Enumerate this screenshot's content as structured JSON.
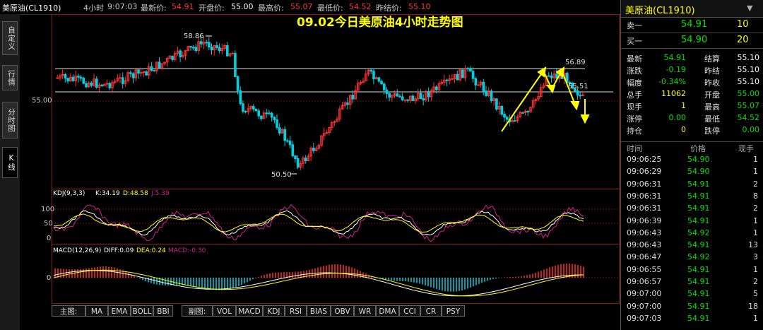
{
  "topbar": {
    "symbol": "美原油(CL1910)",
    "period": "4小时",
    "time": "9:07:03",
    "last_label": "最新价:",
    "last_value": "54.91",
    "open_label": "开盘价:",
    "open_value": "55.00",
    "high_label": "最高价:",
    "high_value": "55.07",
    "low_label": "最低价:",
    "low_value": "54.52",
    "prevclose_label": "昨结价:",
    "prevclose_value": "55.10"
  },
  "left_tabs": [
    "自定义",
    "行情",
    "分时图",
    "K线"
  ],
  "chart": {
    "headline": "09.02今日美原油4小时走势图",
    "price_axis_label": "55.00",
    "labels": {
      "high": "58.86",
      "low": "50.50",
      "right_high": "56.89",
      "right_low": "55.51"
    },
    "kdj_title": "KDJ(9,3,3)",
    "kdj_k": "K:34.19",
    "kdj_d": "D:48.58",
    "kdj_j": "J:5.39",
    "kdj_axis": [
      "100",
      "50",
      "0"
    ],
    "macd_title": "MACD(12,26,9)",
    "macd_diff": "DIFF:0.09",
    "macd_dea": "DEA:0.24",
    "macd_macd": "MACD:-0.30",
    "macd_axis": "0"
  },
  "bottom_buttons": [
    "主图:",
    "MA",
    "EMA",
    "BOLL",
    "BBI",
    "副图:",
    "VOL",
    "MACD",
    "KDJ",
    "RSI",
    "BIAS",
    "OBV",
    "WR",
    "DMA",
    "CCI",
    "CR",
    "PSY"
  ],
  "quote": {
    "title": "美原油(CL1910)",
    "sell_label": "卖一",
    "sell_price": "54.91",
    "sell_qty": "10",
    "buy_label": "买一",
    "buy_price": "54.90",
    "buy_qty": "20",
    "stats": [
      {
        "l1": "最新",
        "v1": "54.91",
        "l2": "结算",
        "v2": "55.10"
      },
      {
        "l1": "涨跌",
        "v1": "-0.19",
        "l2": "昨结",
        "v2": "55.10"
      },
      {
        "l1": "幅度",
        "v1": "-0.34%",
        "l2": "昨收",
        "v2": "55.10"
      },
      {
        "l1": "总手",
        "v1": "11062",
        "l2": "开盘",
        "v2": "55.00"
      },
      {
        "l1": "现手",
        "v1": "1",
        "l2": "最高",
        "v2": "55.07"
      },
      {
        "l1": "涨停",
        "v1": "0.00",
        "l2": "最低",
        "v2": "54.52"
      },
      {
        "l1": "持仓",
        "v1": "0",
        "l2": "跌停",
        "v2": "0.00"
      }
    ],
    "trade_headers": [
      "时间",
      "价格",
      "现手"
    ],
    "trades": [
      {
        "t": "09:06:25",
        "p": "54.90",
        "q": "1"
      },
      {
        "t": "09:06:29",
        "p": "54.90",
        "q": "1"
      },
      {
        "t": "09:06:31",
        "p": "54.91",
        "q": "2"
      },
      {
        "t": "09:06:31",
        "p": "54.91",
        "q": "8"
      },
      {
        "t": "09:06:31",
        "p": "54.91",
        "q": "2"
      },
      {
        "t": "09:06:39",
        "p": "54.91",
        "q": "1"
      },
      {
        "t": "09:06:43",
        "p": "54.92",
        "q": "1"
      },
      {
        "t": "09:06:43",
        "p": "54.91",
        "q": "13"
      },
      {
        "t": "09:06:47",
        "p": "54.92",
        "q": "3"
      },
      {
        "t": "09:06:55",
        "p": "54.91",
        "q": "1"
      },
      {
        "t": "09:06:57",
        "p": "54.91",
        "q": "2"
      },
      {
        "t": "09:07:00",
        "p": "54.91",
        "q": "5"
      },
      {
        "t": "09:07:00",
        "p": "54.91",
        "q": "18"
      },
      {
        "t": "09:07:03",
        "p": "54.91",
        "q": "1"
      }
    ]
  },
  "colors": {
    "up": "#ff3030",
    "down": "#00d0e0",
    "green": "#00e000",
    "yellow": "#ffff00",
    "magenta": "#d0208a",
    "white": "#ffffff"
  }
}
